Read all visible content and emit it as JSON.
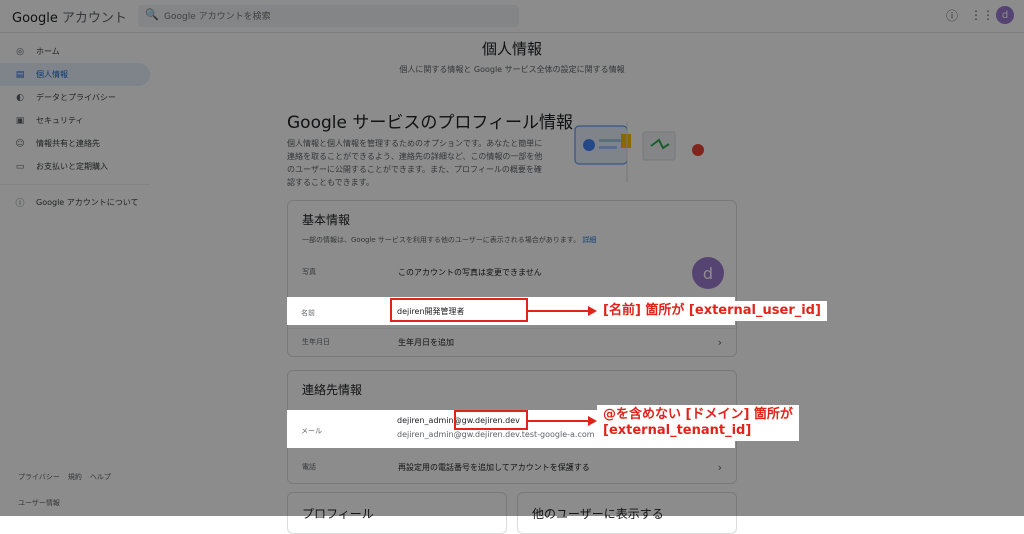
{
  "app": {
    "logo_google": "Google",
    "logo_account": "アカウント",
    "search_placeholder": "Google アカウントを検索"
  },
  "topbar_icons": [
    "help-icon",
    "apps-icon"
  ],
  "user_initial": "d",
  "sidebar": {
    "items": [
      {
        "label": "ホーム",
        "icon": "home-icon"
      },
      {
        "label": "個人情報",
        "icon": "person-card-icon",
        "active": true
      },
      {
        "label": "データとプライバシー",
        "icon": "toggle-icon"
      },
      {
        "label": "セキュリティ",
        "icon": "lock-icon"
      },
      {
        "label": "情報共有と連絡先",
        "icon": "people-icon"
      },
      {
        "label": "お支払いと定期購入",
        "icon": "credit-card-icon"
      }
    ],
    "about_label": "Google アカウントについて",
    "footer_links": [
      "プライバシー",
      "規約",
      "ヘルプ"
    ],
    "footer_extra": "ユーザー情報"
  },
  "page": {
    "title": "個人情報",
    "subtitle": "個人に関する情報と Google サービス全体の設定に関する情報",
    "section_title": "Google サービスのプロフィール情報",
    "section_desc": "個人情報と個人情報を管理するためのオプションです。あなたと簡単に連絡を取ることができるよう、連絡先の詳細など、この情報の一部を他のユーザーに公開することができます。また、プロフィールの概要を確認することもできます。"
  },
  "basic_info": {
    "title": "基本情報",
    "desc": "一部の情報は、Google サービスを利用する他のユーザーに表示される場合があります。",
    "desc_link": "詳細",
    "rows": [
      {
        "label": "写真",
        "value": "このアカウントの写真は変更できません"
      },
      {
        "label": "名前",
        "value": "dejiren開発管理者"
      },
      {
        "label": "生年月日",
        "value": "生年月日を追加"
      }
    ]
  },
  "contact_info": {
    "title": "連絡先情報",
    "email_label": "メール",
    "email_primary": "dejiren_admin@gw.dejiren.dev",
    "email_secondary": "dejiren_admin@gw.dejiren.dev.test-google-a.com",
    "phone_label": "電話",
    "phone_value": "再設定用の電話番号を追加してアカウントを保護する"
  },
  "bottom_cards": [
    "プロフィール",
    "他のユーザーに表示する"
  ],
  "annotations": {
    "callout1": "[名前] 箇所が [external_user_id]",
    "callout2_line1": "@を含めない [ドメイン] 箇所が",
    "callout2_line2": "[external_tenant_id]"
  },
  "colors": {
    "annotation_red": "#e0241b",
    "active_blue": "#1967d2",
    "avatar_purple": "#9b7bd0"
  }
}
